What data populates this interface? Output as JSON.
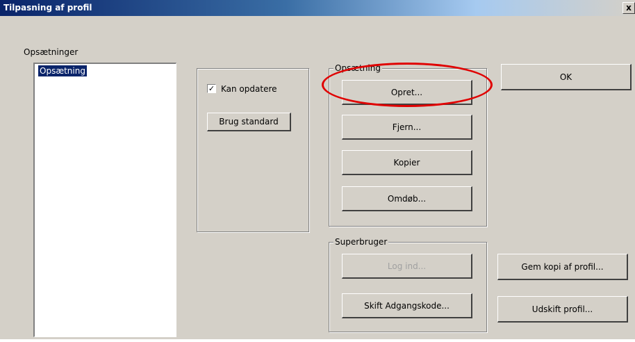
{
  "window": {
    "title": "Tilpasning af profil",
    "close_label": "x"
  },
  "setups": {
    "label": "Opsætninger",
    "items": [
      "Opsætning"
    ]
  },
  "options": {
    "can_update_label": "Kan opdatere",
    "can_update_checked": true,
    "checkmark": "✓",
    "use_default_label": "Brug standard"
  },
  "setup_group": {
    "legend": "Opsætning",
    "create_label": "Opret...",
    "remove_label": "Fjern...",
    "copy_label": "Kopier",
    "rename_label": "Omdøb..."
  },
  "superuser_group": {
    "legend": "Superbruger",
    "login_label": "Log ind...",
    "login_enabled": false,
    "change_password_label": "Skift Adgangskode..."
  },
  "actions": {
    "ok_label": "OK",
    "save_copy_label": "Gem kopi af profil...",
    "replace_label": "Udskift profil..."
  },
  "annotation": {
    "highlight_color": "#e00000"
  }
}
